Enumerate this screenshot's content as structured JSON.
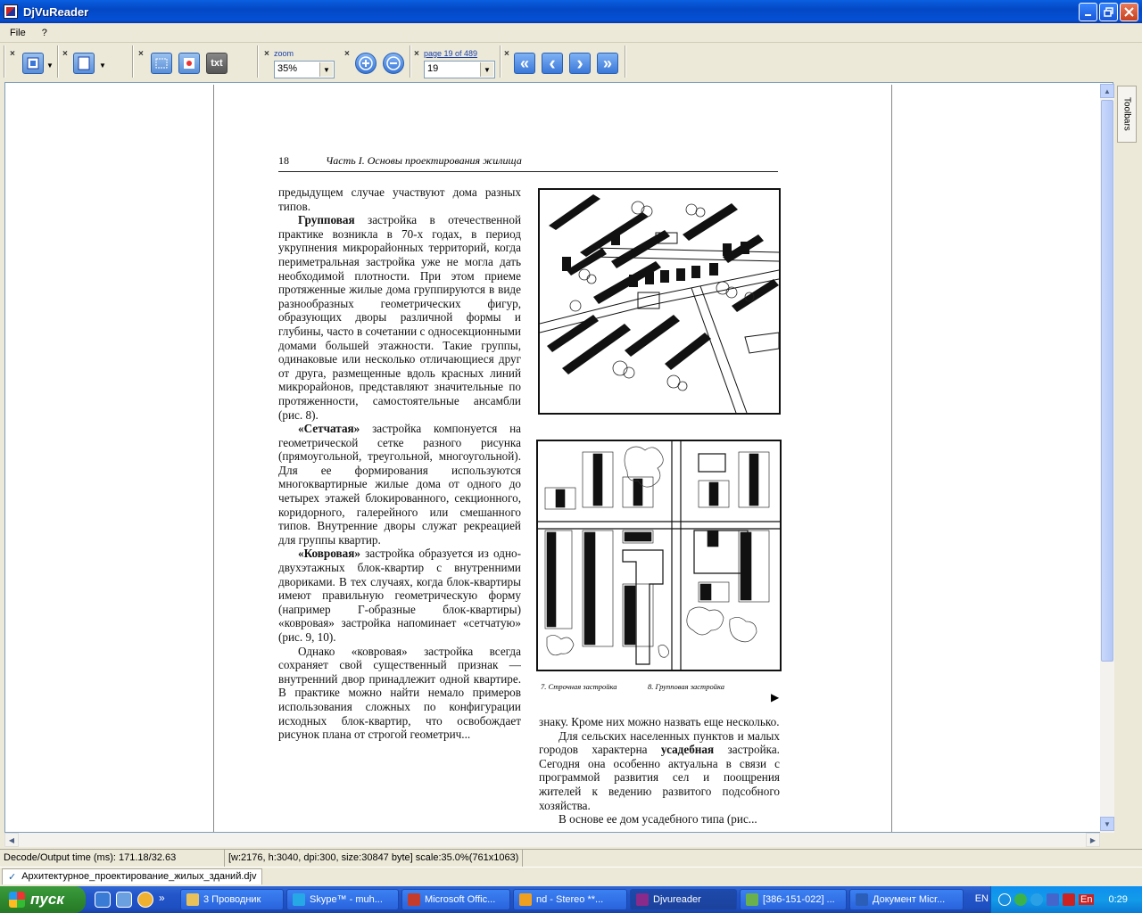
{
  "window": {
    "title": "DjVuReader"
  },
  "menu": {
    "file": "File",
    "help": "?"
  },
  "toolbar": {
    "close_glyph": "×",
    "txt_label": "txt",
    "zoom_label": "zoom",
    "zoom_value": "35%",
    "page_label": "page 19 of 489",
    "page_value": "19",
    "nav": {
      "first": "«",
      "prev": "‹",
      "next": "›",
      "last": "»"
    }
  },
  "side_tab": "Toolbars",
  "document": {
    "page_number": "18",
    "running_head": "Часть I. Основы проектирования жилища",
    "left_column": {
      "p1": "предыдущем случае участвуют дома разных типов.",
      "p2_bold": "Групповая",
      "p2": " застройка в отечественной практике возникла в 70-х годах, в период укрупнения микрорайонных территорий, когда периметральная застройка уже не могла дать необходимой плотности. При этом приеме протяженные жилые дома группируются в виде разнообразных геометрических фигур, образующих дворы различной формы и глубины, часто в сочетании с односекционными домами большей этажности. Такие группы, одинаковые или несколько отличающиеся друг от друга, размещенные вдоль красных линий микрорайонов, представляют значительные по протяженности, самостоятельные ансамбли (рис. 8).",
      "p3_bold": "«Сетчатая»",
      "p3": " застройка компонуется на геометрической сетке разного рисунка (прямоугольной, треугольной, многоугольной). Для ее формирования используются многоквартирные жилые дома от одного до четырех этажей блокированного, секционного, коридорного, галерейного или смешанного типов. Внутренние дворы служат рекреацией для группы квартир.",
      "p4_bold": "«Ковровая»",
      "p4": " застройка образуется из одно-двухэтажных блок-квартир с внутренними двориками. В тех случаях, когда блок-квартиры имеют правильную геометрическую форму (например Г-образные блок-квартиры) «ковровая» застройка напоминает «сетчатую» (рис. 9, 10).",
      "p5": "Однако «ковровая» застройка всегда сохраняет свой существенный признак — внутренний двор принадлежит одной квартире. В практике можно найти немало примеров использования сложных по конфигурации исходных блок-квартир, что освобождает рисунок плана от строгой геометрич..."
    },
    "right_column": {
      "p1": "знаку. Кроме них можно назвать еще несколько.",
      "p2a": "Для сельских населенных пунктов и малых городов характерна ",
      "p2_bold": "усадебная",
      "p2b": " застройка. Сегодня она особенно актуальна  в связи с программой развития сел и поощрения жителей к ведению развитого подсобного хозяйства.",
      "p3": "В основе ее дом усадебного типа (рис..."
    },
    "captions": {
      "fig7": "7. Строчная застройка",
      "fig8": "8. Групповая застройка"
    },
    "play_glyph": "▶"
  },
  "status": {
    "decode": "Decode/Output time (ms): 171.18/32.63",
    "info": "[w:2176, h:3040, dpi:300, size:30847 byte] scale:35.0%(761x1063)"
  },
  "file_tab": {
    "check": "✓",
    "name": "Архитектурное_проектирование_жилых_зданий.djv"
  },
  "taskbar": {
    "start": "пуск",
    "chevron": "»",
    "tasks": [
      {
        "label": "3 Проводник",
        "color": "#e8c15a"
      },
      {
        "label": "Skype™ - muh...",
        "color": "#27a8e6"
      },
      {
        "label": "Microsoft Offic...",
        "color": "#c63c2c"
      },
      {
        "label": "nd - Stereo **...",
        "color": "#f0a020"
      },
      {
        "label": "Djvureader",
        "color": "#8a2a8a"
      },
      {
        "label": "[386-151-022] ...",
        "color": "#6ab04c"
      },
      {
        "label": "Документ Micr...",
        "color": "#2b5eb8"
      }
    ],
    "lang": "EN",
    "tray_lang": "En",
    "clock": "0:29"
  }
}
